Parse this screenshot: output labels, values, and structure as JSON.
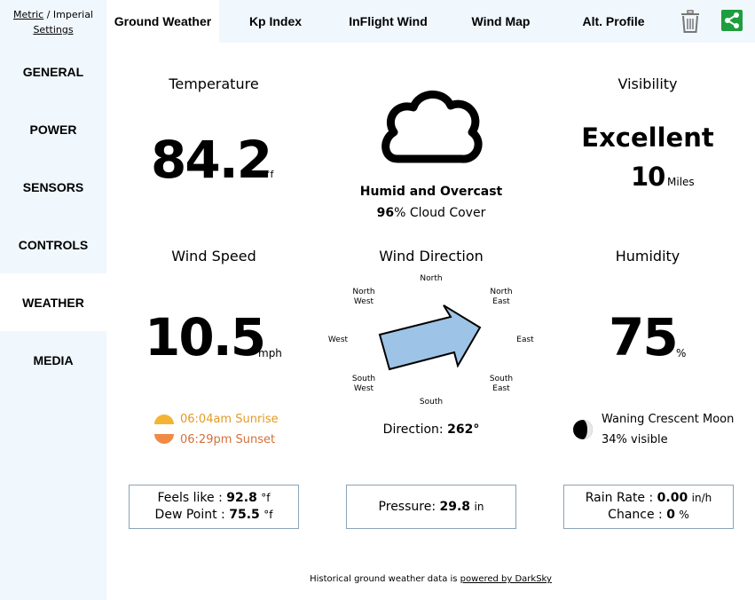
{
  "units": {
    "metric": "Metric",
    "separator": " / ",
    "imperial": "Imperial",
    "settings": "Settings"
  },
  "sidebar": {
    "items": [
      {
        "label": "GENERAL"
      },
      {
        "label": "POWER"
      },
      {
        "label": "SENSORS"
      },
      {
        "label": "CONTROLS"
      },
      {
        "label": "WEATHER"
      },
      {
        "label": "MEDIA"
      }
    ],
    "active": "WEATHER"
  },
  "tabs": [
    {
      "label": "Ground Weather"
    },
    {
      "label": "Kp Index"
    },
    {
      "label": "InFlight Wind"
    },
    {
      "label": "Wind Map"
    },
    {
      "label": "Alt. Profile"
    }
  ],
  "actions": {
    "trash_icon": "trash-icon",
    "share_icon": "share-icon",
    "share_color": "#1e9e3e"
  },
  "temperature": {
    "title": "Temperature",
    "value": "84.2",
    "unit": "°f"
  },
  "sky": {
    "icon": "cloud-icon",
    "condition": "Humid and Overcast",
    "cloud_value": "96",
    "cloud_text": "% Cloud Cover"
  },
  "visibility": {
    "title": "Visibility",
    "rating": "Excellent",
    "value": "10",
    "unit": "Miles"
  },
  "wind_speed": {
    "title": "Wind Speed",
    "value": "10.5",
    "unit": "mph"
  },
  "wind_direction": {
    "title": "Wind Direction",
    "labels": {
      "n": "North",
      "nw1": "North",
      "nw2": "West",
      "ne1": "North",
      "ne2": "East",
      "w": "West",
      "e": "East",
      "sw1": "South",
      "sw2": "West",
      "se1": "South",
      "se2": "East",
      "s": "South"
    },
    "direction_label": "Direction: ",
    "direction_value": "262°",
    "arrow_color": "#9dc3e6"
  },
  "humidity": {
    "title": "Humidity",
    "value": "75",
    "unit": "%"
  },
  "sun": {
    "sunrise": "06:04am Sunrise",
    "sunset": "06:29pm Sunset",
    "sunrise_color": "#f0a030",
    "sunset_color": "#d4703a"
  },
  "moon": {
    "phase": "Waning Crescent Moon",
    "visible": "34% visible"
  },
  "feels": {
    "feels_label": "Feels like : ",
    "feels_value": "92.8",
    "feels_unit": "°f",
    "dew_label": "Dew Point : ",
    "dew_value": "75.5",
    "dew_unit": "°f"
  },
  "pressure": {
    "label": "Pressure: ",
    "value": "29.8",
    "unit": "in"
  },
  "rain": {
    "rate_label": "Rain Rate : ",
    "rate_value": "0.00",
    "rate_unit": "in/h",
    "chance_label": "Chance : ",
    "chance_value": "0",
    "chance_unit": "%"
  },
  "footer": {
    "text": "Historical ground weather data is ",
    "link": "powered by DarkSky"
  }
}
